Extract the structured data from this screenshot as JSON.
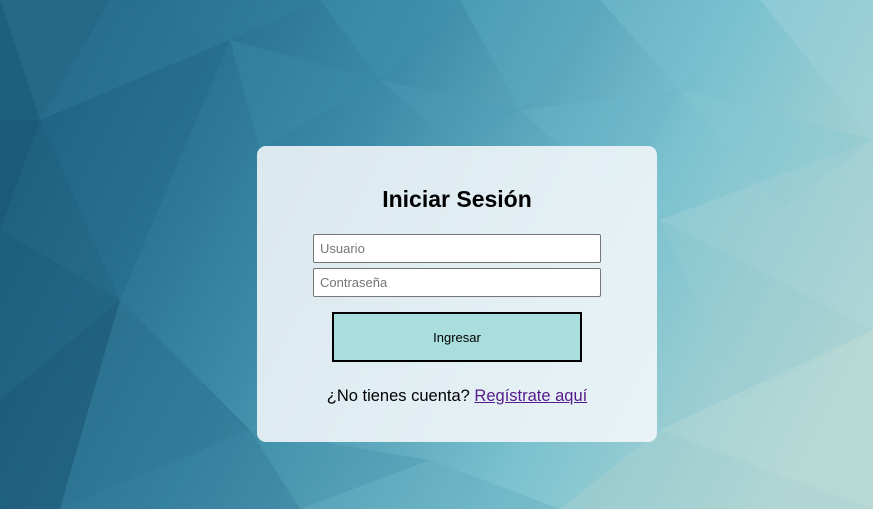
{
  "login": {
    "title": "Iniciar Sesión",
    "username_placeholder": "Usuario",
    "username_value": "",
    "password_placeholder": "Contraseña",
    "password_value": "",
    "submit_label": "Ingresar",
    "signup_prompt": "¿No tienes cuenta?",
    "signup_link": "Regístrate aquí"
  },
  "colors": {
    "button_bg": "#a8dedd",
    "link": "#551a8b",
    "card_bg": "#f4f7f9"
  }
}
